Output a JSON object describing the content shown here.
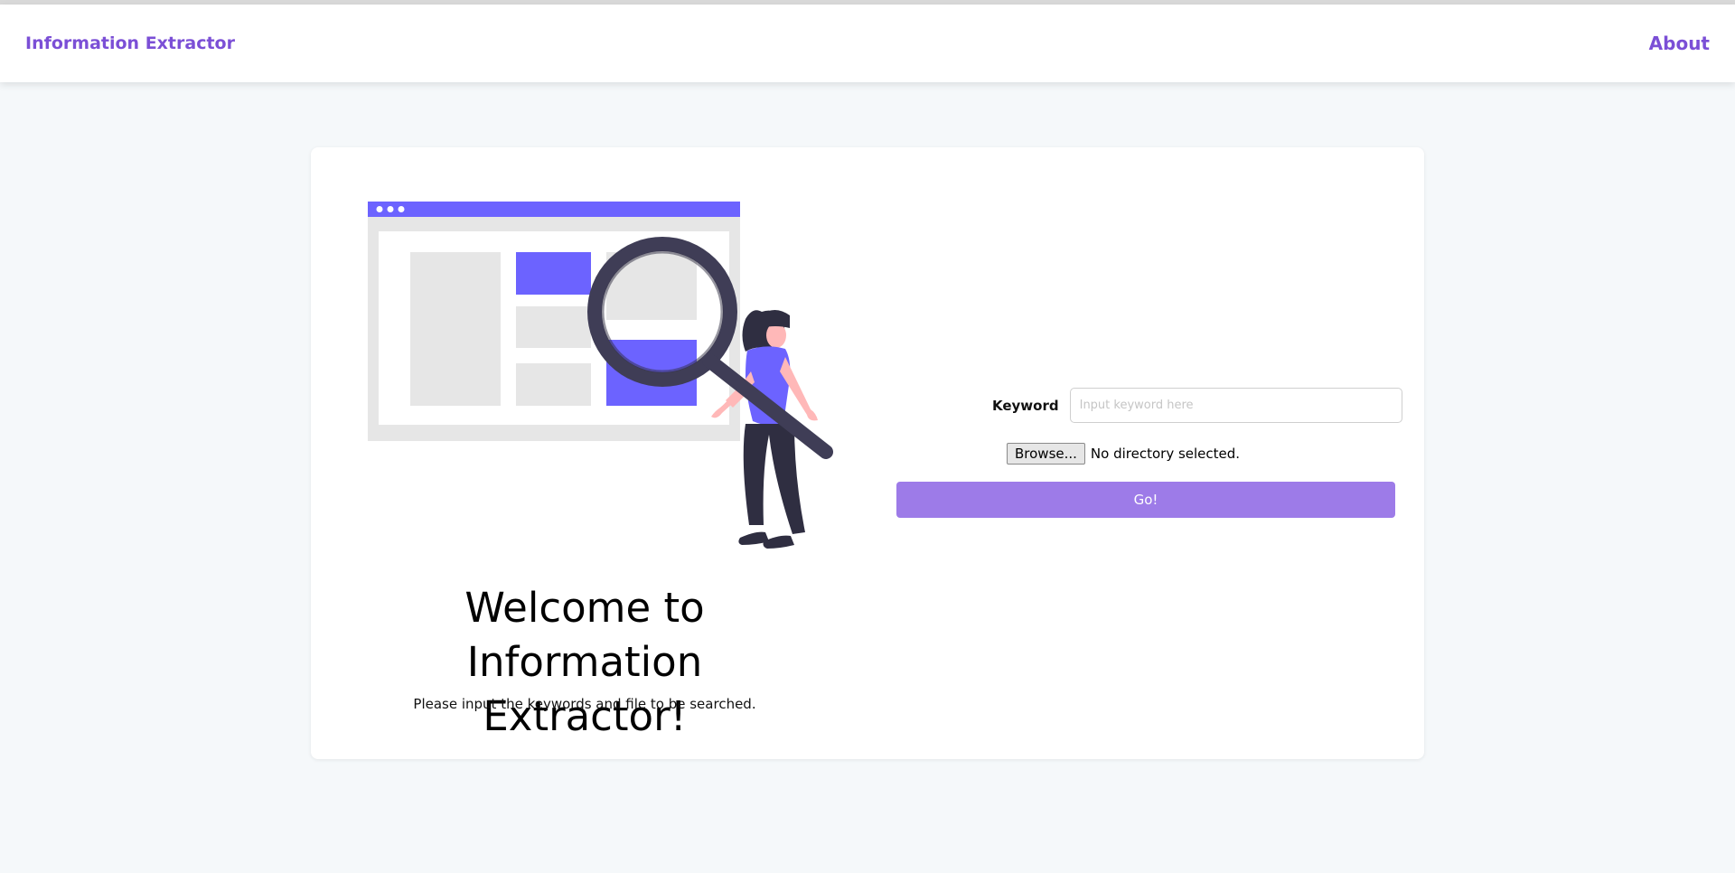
{
  "navbar": {
    "brand": "Information Extractor",
    "about_link": "About"
  },
  "hero": {
    "title_line1": "Welcome to",
    "title_line2": "Information Extractor!",
    "subtitle": "Please input the keywords and file to be searched."
  },
  "form": {
    "keyword_label": "Keyword",
    "keyword_value": "",
    "keyword_placeholder": "Input keyword here",
    "browse_label": "Browse...",
    "directory_status": "No directory selected.",
    "submit_label": "Go!"
  },
  "colors": {
    "accent": "#7b4fd6",
    "illustration_primary": "#6c63ff",
    "button": "#9d7be8",
    "page_background": "#f5f8fa"
  }
}
